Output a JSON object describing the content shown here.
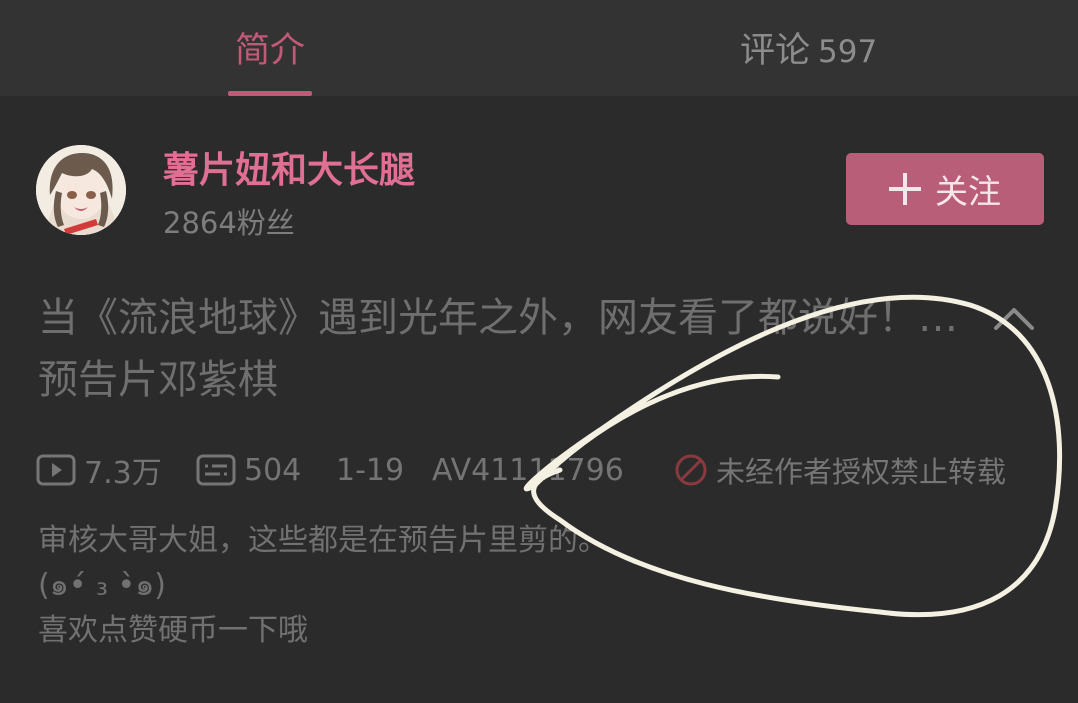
{
  "tabs": {
    "intro_label": "简介",
    "comments_label": "评论",
    "comments_count": "597"
  },
  "uploader": {
    "name": "薯片妞和大长腿",
    "fans": "2864粉丝",
    "avatar_icon": "anime-girl-avatar",
    "follow_label": "关注",
    "follow_icon": "plus-icon"
  },
  "video": {
    "title": "当《流浪地球》遇到光年之外，网友看了都说好！…预告片邓紫棋",
    "collapse_icon": "chevron-up-icon",
    "views": "7.3万",
    "danmaku": "504",
    "date": "1-19",
    "av": "AV41111796",
    "no_reprint": "未经作者授权禁止转载"
  },
  "description": {
    "line1": "审核大哥大姐，这些都是在预告片里剪的。",
    "line2": "(๑•́ ₃ •̀๑)",
    "line3": "喜欢点赞硬币一下哦"
  },
  "colors": {
    "background": "#2b2b2b",
    "tabs_background": "#333333",
    "accent_pink": "#c05a77",
    "uploader_name": "#e06f93",
    "follow_button": "#b85e78",
    "muted_text": "#717171",
    "annotation_stroke": "#f4f0e2"
  }
}
